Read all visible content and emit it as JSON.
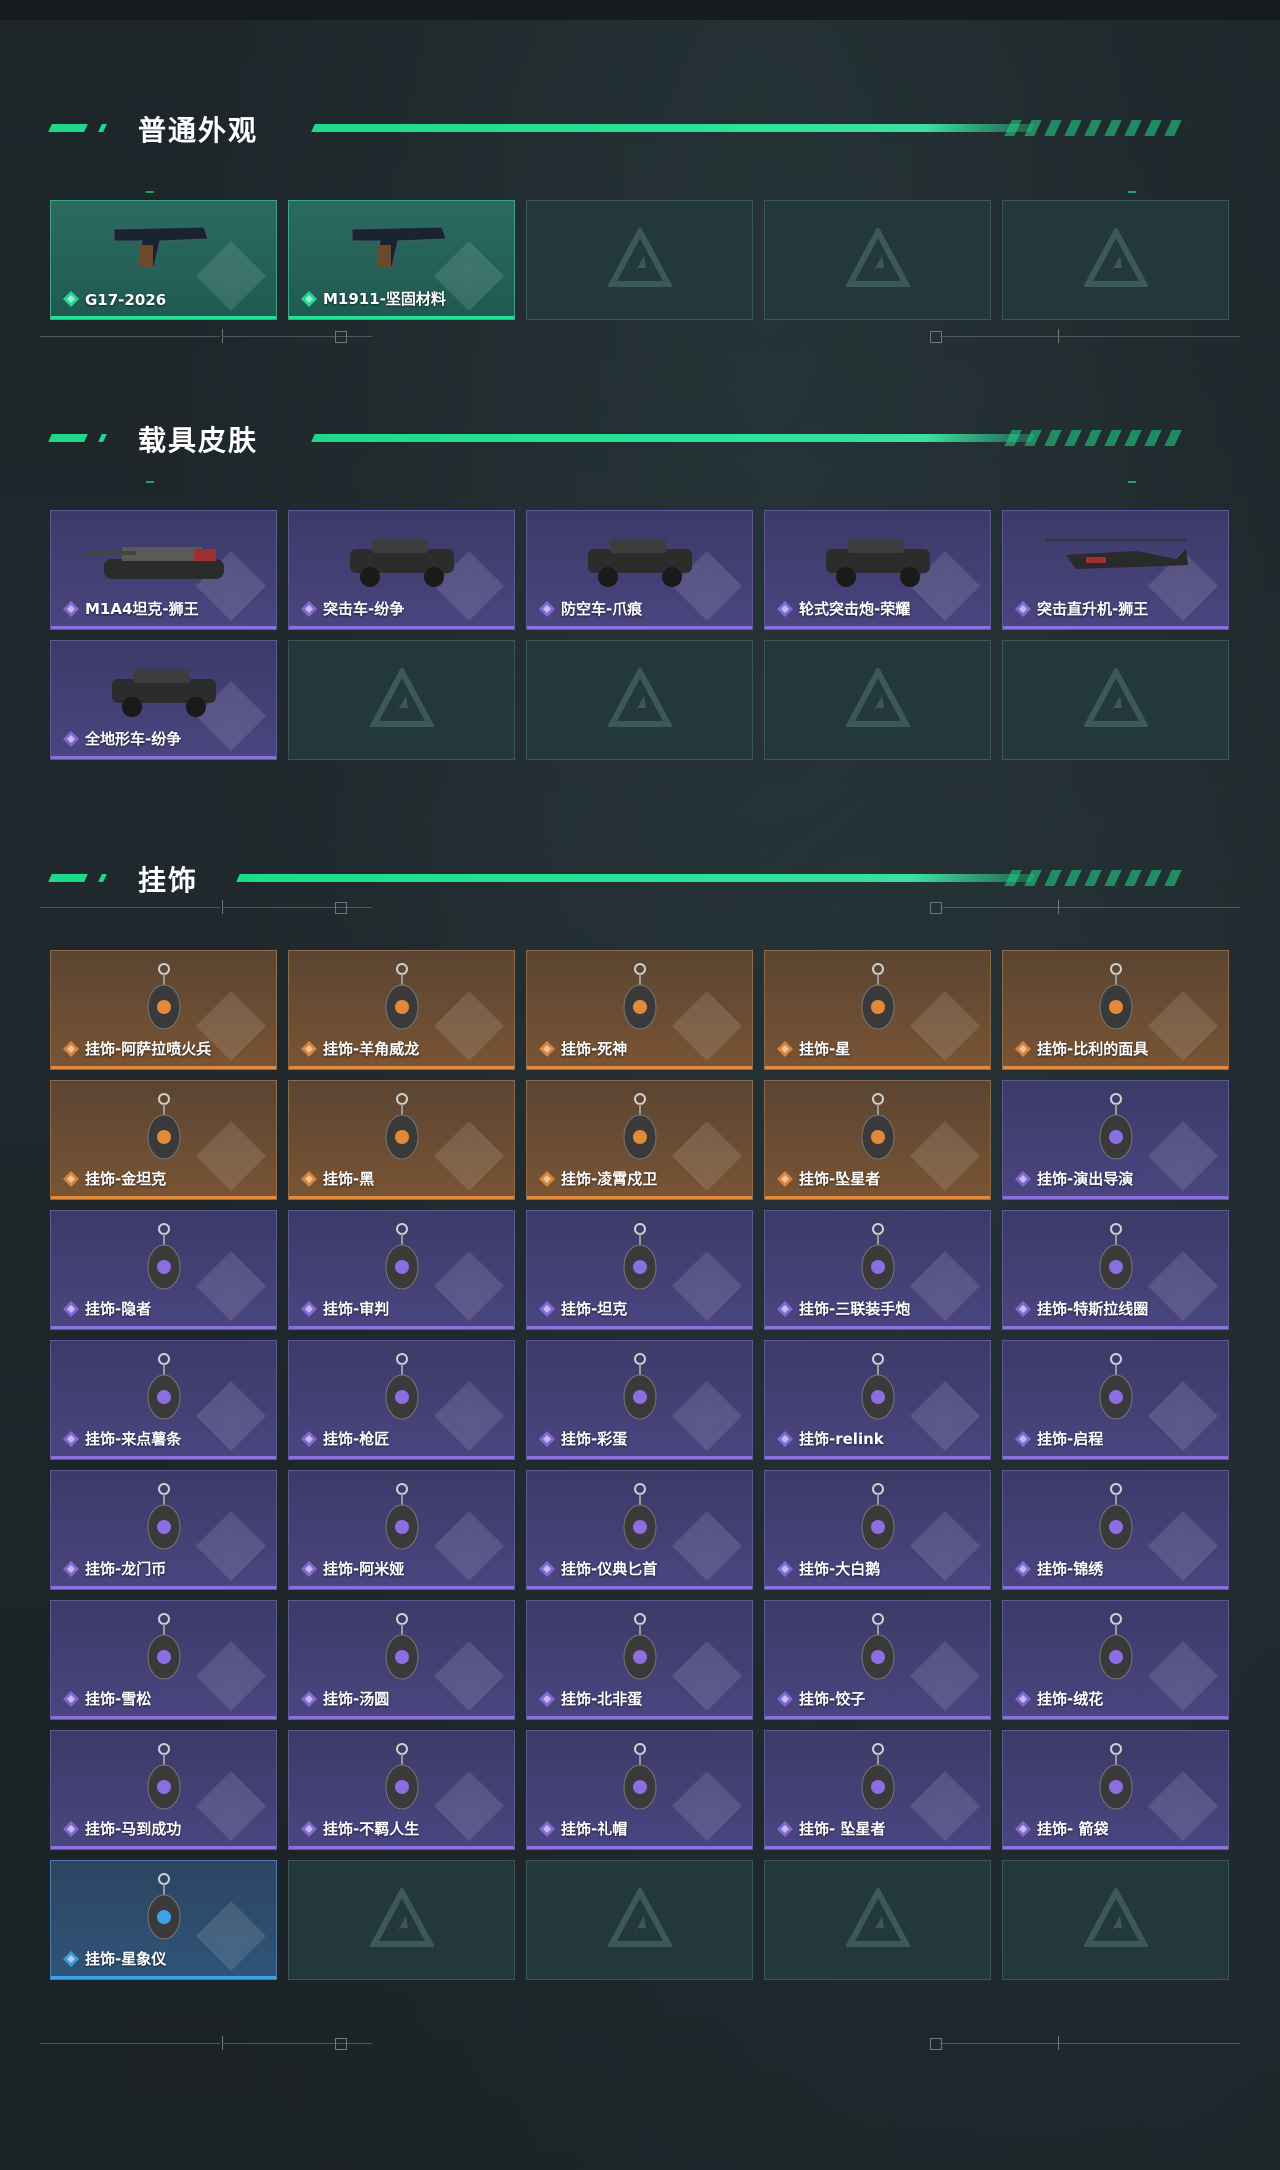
{
  "theme": {
    "accent": "#1fd98a",
    "rarity_colors": {
      "green": "#23e39a",
      "purple": "#8b6ee0",
      "orange": "#e38a3a",
      "blue": "#3ea2e8"
    }
  },
  "sections": {
    "appearance": {
      "title": "普通外观",
      "items": [
        {
          "label": "G17-2026",
          "rarity": "green",
          "icon": "pistol-icon"
        },
        {
          "label": "M1911-坚固材料",
          "rarity": "green",
          "icon": "pistol-icon"
        }
      ]
    },
    "vehicle": {
      "title": "载具皮肤",
      "items": [
        {
          "label": "M1A4坦克-狮王",
          "rarity": "purple",
          "icon": "tank-icon"
        },
        {
          "label": "突击车-纷争",
          "rarity": "purple",
          "icon": "assault-vehicle-icon"
        },
        {
          "label": "防空车-爪痕",
          "rarity": "purple",
          "icon": "aa-vehicle-icon"
        },
        {
          "label": "轮式突击炮-荣耀",
          "rarity": "purple",
          "icon": "wheeled-gun-icon"
        },
        {
          "label": "突击直升机-狮王",
          "rarity": "purple",
          "icon": "helicopter-icon"
        },
        {
          "label": "全地形车-纷争",
          "rarity": "purple",
          "icon": "atv-icon"
        }
      ]
    },
    "charms": {
      "title": "挂饰",
      "items": [
        {
          "label": "挂饰-阿萨拉喷火兵",
          "rarity": "orange",
          "icon": "charm-icon"
        },
        {
          "label": "挂饰-羊角威龙",
          "rarity": "orange",
          "icon": "charm-icon"
        },
        {
          "label": "挂饰-死神",
          "rarity": "orange",
          "icon": "charm-icon"
        },
        {
          "label": "挂饰-星",
          "rarity": "orange",
          "icon": "charm-icon"
        },
        {
          "label": "挂饰-比利的面具",
          "rarity": "orange",
          "icon": "charm-icon"
        },
        {
          "label": "挂饰-金坦克",
          "rarity": "orange",
          "icon": "charm-icon"
        },
        {
          "label": "挂饰-黑",
          "rarity": "orange",
          "icon": "charm-icon"
        },
        {
          "label": "挂饰-凌霄戍卫",
          "rarity": "orange",
          "icon": "charm-icon"
        },
        {
          "label": "挂饰-坠星者",
          "rarity": "orange",
          "icon": "charm-icon"
        },
        {
          "label": "挂饰-演出导演",
          "rarity": "purple",
          "icon": "charm-icon"
        },
        {
          "label": "挂饰-隐者",
          "rarity": "purple",
          "icon": "charm-icon"
        },
        {
          "label": "挂饰-审判",
          "rarity": "purple",
          "icon": "charm-icon"
        },
        {
          "label": "挂饰-坦克",
          "rarity": "purple",
          "icon": "charm-icon"
        },
        {
          "label": "挂饰-三联装手炮",
          "rarity": "purple",
          "icon": "charm-icon"
        },
        {
          "label": "挂饰-特斯拉线圈",
          "rarity": "purple",
          "icon": "charm-icon"
        },
        {
          "label": "挂饰-来点薯条",
          "rarity": "purple",
          "icon": "charm-icon"
        },
        {
          "label": "挂饰-枪匠",
          "rarity": "purple",
          "icon": "charm-icon"
        },
        {
          "label": "挂饰-彩蛋",
          "rarity": "purple",
          "icon": "charm-icon"
        },
        {
          "label": "挂饰-relink",
          "rarity": "purple",
          "icon": "charm-icon"
        },
        {
          "label": "挂饰-启程",
          "rarity": "purple",
          "icon": "charm-icon"
        },
        {
          "label": "挂饰-龙门币",
          "rarity": "purple",
          "icon": "charm-icon"
        },
        {
          "label": "挂饰-阿米娅",
          "rarity": "purple",
          "icon": "charm-icon"
        },
        {
          "label": "挂饰-仪典匕首",
          "rarity": "purple",
          "icon": "charm-icon"
        },
        {
          "label": "挂饰-大白鹅",
          "rarity": "purple",
          "icon": "charm-icon"
        },
        {
          "label": "挂饰-锦绣",
          "rarity": "purple",
          "icon": "charm-icon"
        },
        {
          "label": "挂饰-雪松",
          "rarity": "purple",
          "icon": "charm-icon"
        },
        {
          "label": "挂饰-汤圆",
          "rarity": "purple",
          "icon": "charm-icon"
        },
        {
          "label": "挂饰-北非蛋",
          "rarity": "purple",
          "icon": "charm-icon"
        },
        {
          "label": "挂饰-饺子",
          "rarity": "purple",
          "icon": "charm-icon"
        },
        {
          "label": "挂饰-绒花",
          "rarity": "purple",
          "icon": "charm-icon"
        },
        {
          "label": "挂饰-马到成功",
          "rarity": "purple",
          "icon": "charm-icon"
        },
        {
          "label": "挂饰-不羁人生",
          "rarity": "purple",
          "icon": "charm-icon"
        },
        {
          "label": "挂饰-礼帽",
          "rarity": "purple",
          "icon": "charm-icon"
        },
        {
          "label": "挂饰- 坠星者",
          "rarity": "purple",
          "icon": "charm-icon"
        },
        {
          "label": "挂饰- 箭袋",
          "rarity": "purple",
          "icon": "charm-icon"
        },
        {
          "label": "挂饰-星象仪",
          "rarity": "blue",
          "icon": "charm-icon"
        }
      ]
    }
  }
}
